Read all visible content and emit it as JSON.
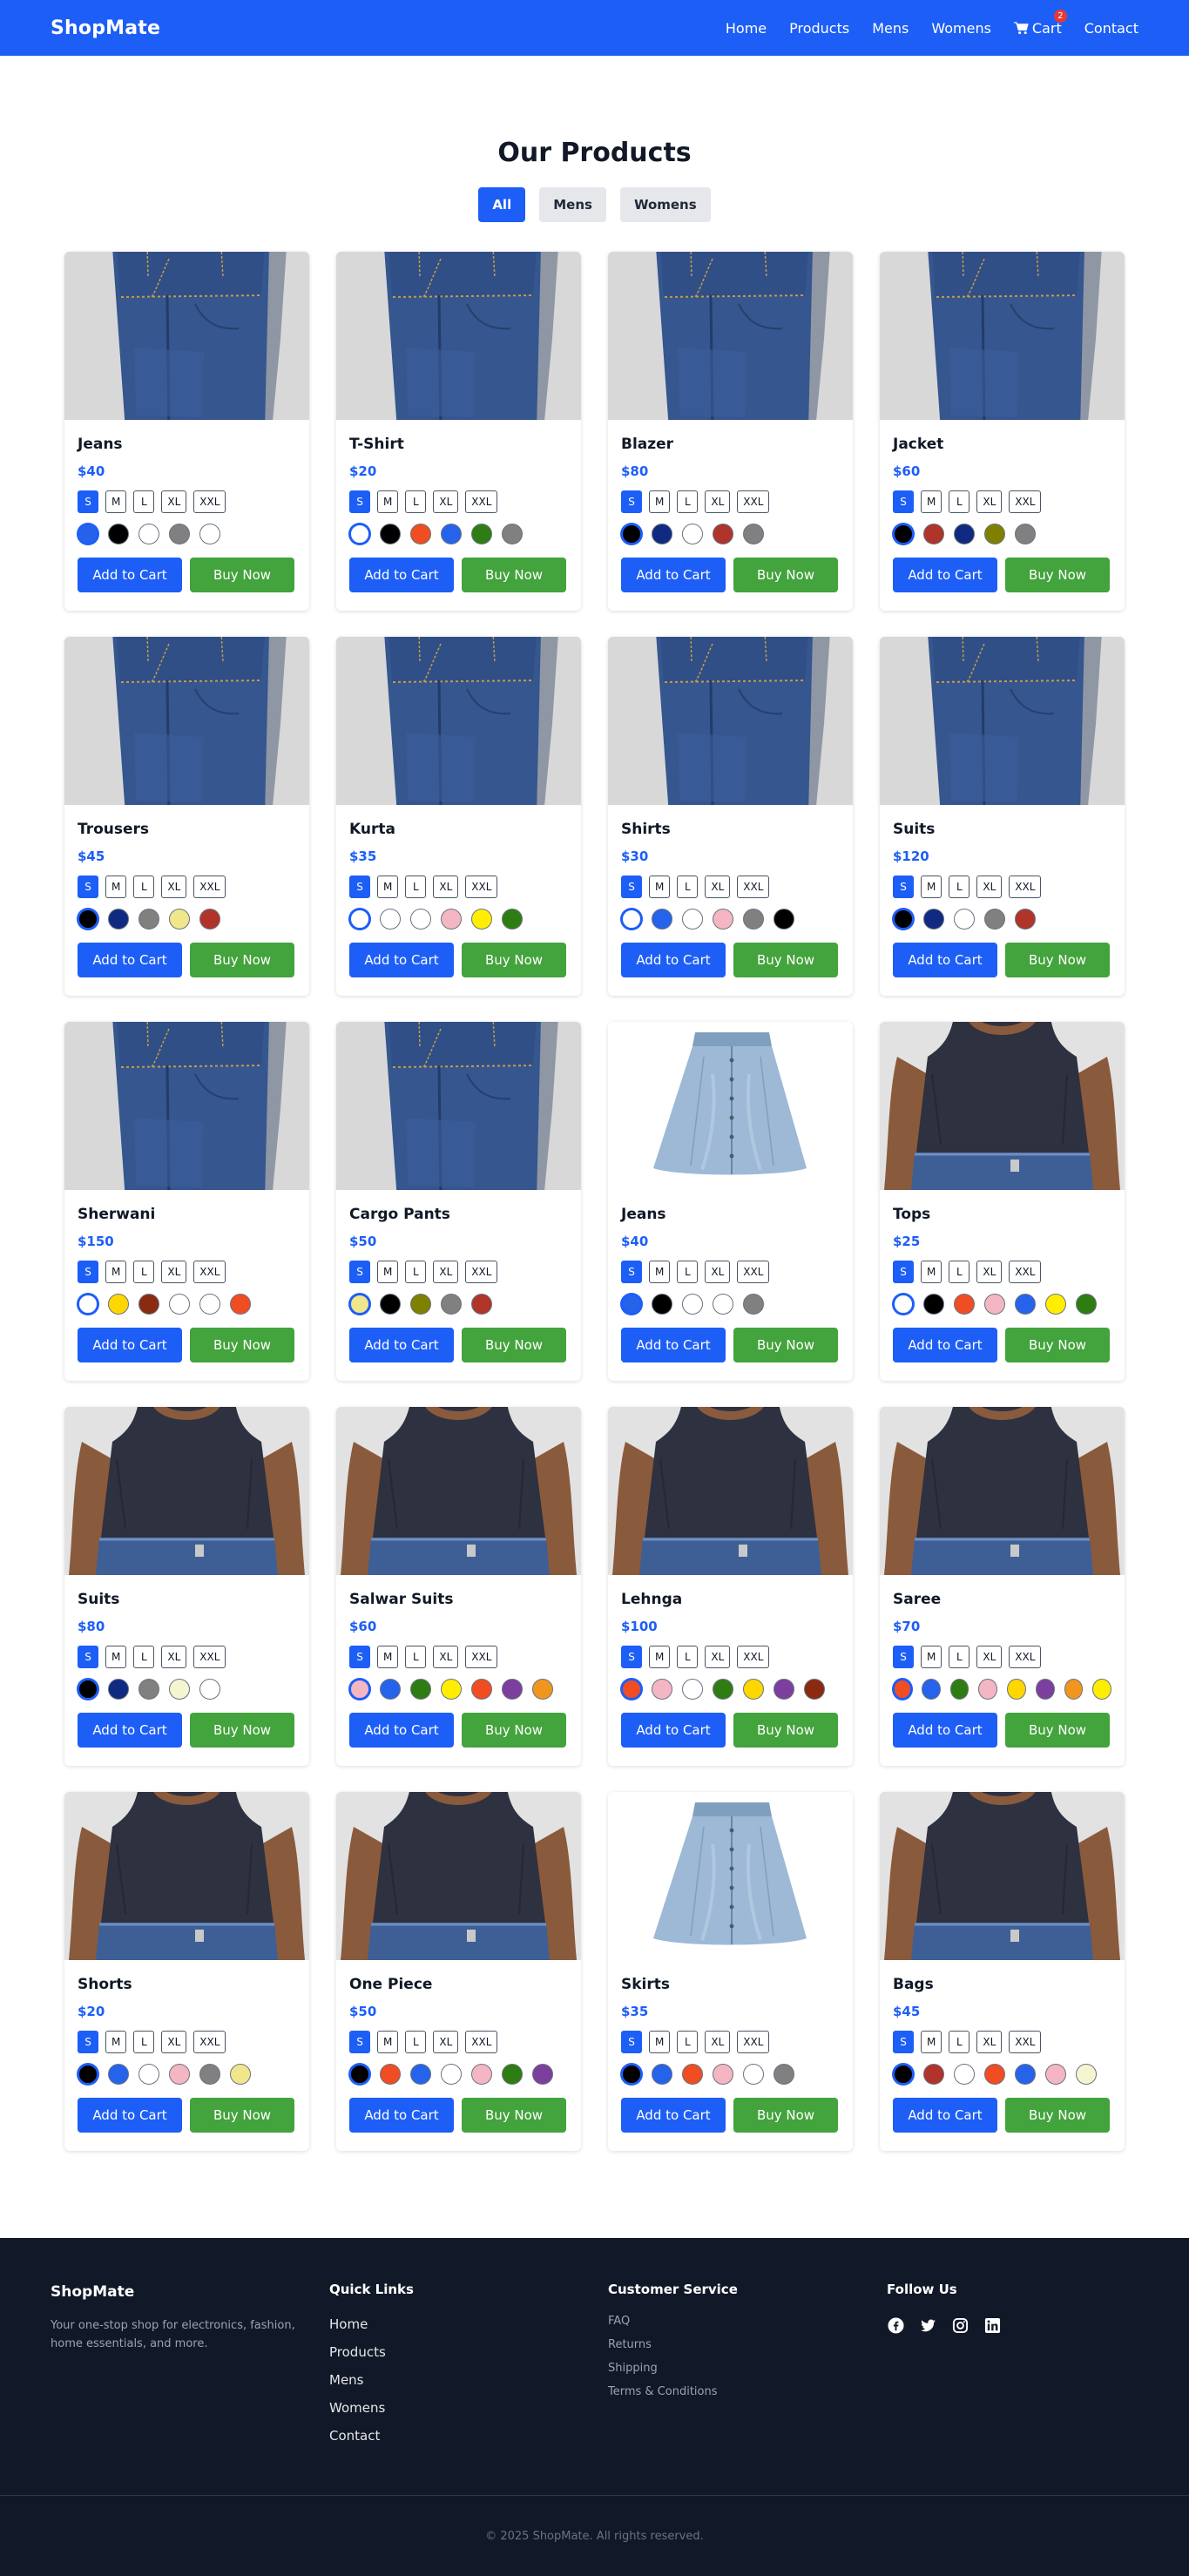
{
  "brand": "ShopMate",
  "nav": {
    "links": [
      "Home",
      "Products",
      "Mens",
      "Womens"
    ],
    "cart_label": "Cart",
    "cart_count": "2",
    "contact_label": "Contact"
  },
  "products_section": {
    "title": "Our Products",
    "filters": [
      {
        "label": "All",
        "active": true
      },
      {
        "label": "Mens",
        "active": false
      },
      {
        "label": "Womens",
        "active": false
      }
    ],
    "add_to_cart_label": "Add to Cart",
    "buy_now_label": "Buy Now",
    "sizes": [
      "S",
      "M",
      "L",
      "XL",
      "XXL"
    ],
    "selected_size": "S"
  },
  "products": [
    {
      "name": "Jeans",
      "price": "$40",
      "image": "jeans",
      "colors": [
        "#2563eb",
        "#000000",
        "#ffffff",
        "#808080",
        "#ffffff"
      ]
    },
    {
      "name": "T-Shirt",
      "price": "$20",
      "image": "jeans",
      "colors": [
        "#ffffff",
        "#000000",
        "#f04d23",
        "#2563eb",
        "#2e7d12",
        "#808080"
      ]
    },
    {
      "name": "Blazer",
      "price": "$80",
      "image": "jeans",
      "colors": [
        "#000000",
        "#0f2a80",
        "#ffffff",
        "#b0342a",
        "#808080"
      ]
    },
    {
      "name": "Jacket",
      "price": "$60",
      "image": "jeans",
      "colors": [
        "#000000",
        "#b0342a",
        "#0f2a80",
        "#808000",
        "#808080"
      ]
    },
    {
      "name": "Trousers",
      "price": "$45",
      "image": "jeans",
      "colors": [
        "#000000",
        "#0f2a80",
        "#808080",
        "#f0e68c",
        "#b0342a"
      ]
    },
    {
      "name": "Kurta",
      "price": "$35",
      "image": "jeans",
      "colors": [
        "#ffffff",
        "#ffffff",
        "#ffffff",
        "#f4b6c2",
        "#ffee00",
        "#2e7d12"
      ]
    },
    {
      "name": "Shirts",
      "price": "$30",
      "image": "jeans",
      "colors": [
        "#ffffff",
        "#2563eb",
        "#ffffff",
        "#f4b6c2",
        "#808080",
        "#000000"
      ]
    },
    {
      "name": "Suits",
      "price": "$120",
      "image": "jeans",
      "colors": [
        "#000000",
        "#0f2a80",
        "#ffffff",
        "#808080",
        "#b0342a"
      ]
    },
    {
      "name": "Sherwani",
      "price": "$150",
      "image": "jeans",
      "colors": [
        "#ffffff",
        "#ffd700",
        "#8b2a10",
        "#ffffff",
        "#ffffff",
        "#f04d23"
      ]
    },
    {
      "name": "Cargo Pants",
      "price": "$50",
      "image": "jeans",
      "colors": [
        "#f0e68c",
        "#000000",
        "#808000",
        "#808080",
        "#b0342a"
      ]
    },
    {
      "name": "Jeans",
      "price": "$40",
      "image": "skirt",
      "colors": [
        "#2563eb",
        "#000000",
        "#ffffff",
        "#ffffff",
        "#808080"
      ]
    },
    {
      "name": "Tops",
      "price": "$25",
      "image": "top",
      "colors": [
        "#ffffff",
        "#000000",
        "#f04d23",
        "#f4b6c2",
        "#2563eb",
        "#ffee00",
        "#2e7d12"
      ]
    },
    {
      "name": "Suits",
      "price": "$80",
      "image": "top",
      "colors": [
        "#000000",
        "#0f2a80",
        "#808080",
        "#f5f5d0",
        "#ffffff"
      ]
    },
    {
      "name": "Salwar Suits",
      "price": "$60",
      "image": "top",
      "colors": [
        "#f4b6c2",
        "#2563eb",
        "#2e7d12",
        "#ffee00",
        "#f04d23",
        "#7b3f9e",
        "#f0961e"
      ]
    },
    {
      "name": "Lehnga",
      "price": "$100",
      "image": "top",
      "colors": [
        "#f04d23",
        "#f4b6c2",
        "#ffffff",
        "#2e7d12",
        "#ffd700",
        "#7b3f9e",
        "#8b2a10"
      ]
    },
    {
      "name": "Saree",
      "price": "$70",
      "image": "top",
      "colors": [
        "#f04d23",
        "#2563eb",
        "#2e7d12",
        "#f4b6c2",
        "#ffd700",
        "#7b3f9e",
        "#f0961e",
        "#ffee00"
      ]
    },
    {
      "name": "Shorts",
      "price": "$20",
      "image": "top",
      "colors": [
        "#000000",
        "#2563eb",
        "#ffffff",
        "#f4b6c2",
        "#808080",
        "#f0e68c"
      ]
    },
    {
      "name": "One Piece",
      "price": "$50",
      "image": "top",
      "colors": [
        "#000000",
        "#f04d23",
        "#2563eb",
        "#ffffff",
        "#f4b6c2",
        "#2e7d12",
        "#7b3f9e"
      ]
    },
    {
      "name": "Skirts",
      "price": "$35",
      "image": "skirt",
      "colors": [
        "#000000",
        "#2563eb",
        "#f04d23",
        "#f4b6c2",
        "#ffffff",
        "#808080"
      ]
    },
    {
      "name": "Bags",
      "price": "$45",
      "image": "top",
      "colors": [
        "#000000",
        "#b0342a",
        "#ffffff",
        "#f04d23",
        "#2563eb",
        "#f4b6c2",
        "#f5f5d0"
      ]
    }
  ],
  "footer": {
    "brand": "ShopMate",
    "description": "Your one-stop shop for electronics, fashion, home essentials, and more.",
    "quick_links_heading": "Quick Links",
    "quick_links": [
      "Home",
      "Products",
      "Mens",
      "Womens",
      "Contact"
    ],
    "customer_service_heading": "Customer Service",
    "customer_service": [
      "FAQ",
      "Returns",
      "Shipping",
      "Terms & Conditions"
    ],
    "follow_us_heading": "Follow Us",
    "socials": [
      "facebook-icon",
      "twitter-icon",
      "instagram-icon",
      "linkedin-icon"
    ],
    "copyright": "© 2025 ShopMate. All rights reserved."
  }
}
